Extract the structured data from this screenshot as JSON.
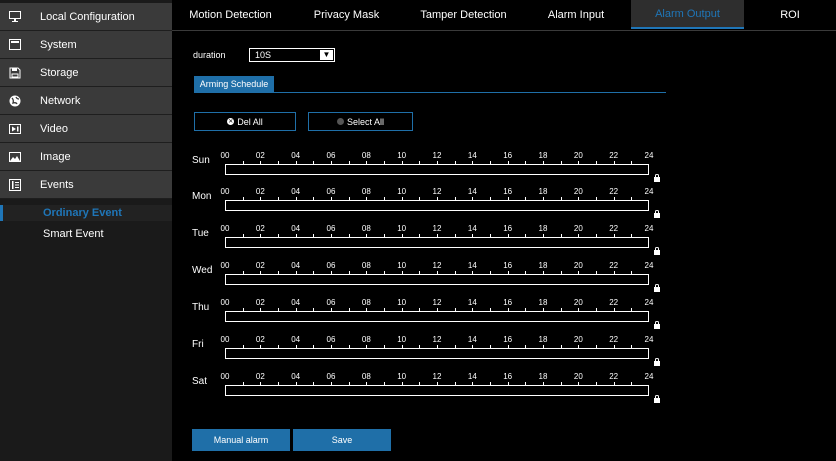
{
  "sidebar": {
    "items": [
      {
        "label": "Local Configuration",
        "icon": "monitor-icon"
      },
      {
        "label": "System",
        "icon": "system-icon"
      },
      {
        "label": "Storage",
        "icon": "storage-icon"
      },
      {
        "label": "Network",
        "icon": "network-globe-icon"
      },
      {
        "label": "Video",
        "icon": "video-icon"
      },
      {
        "label": "Image",
        "icon": "image-icon"
      },
      {
        "label": "Events",
        "icon": "events-icon"
      }
    ],
    "sub_items": [
      {
        "label": "Ordinary Event",
        "active": true
      },
      {
        "label": "Smart Event",
        "active": false
      }
    ]
  },
  "tabs": [
    {
      "label": "Motion Detection",
      "active": false
    },
    {
      "label": "Privacy Mask",
      "active": false
    },
    {
      "label": "Tamper Detection",
      "active": false
    },
    {
      "label": "Alarm Input",
      "active": false
    },
    {
      "label": "Alarm Output",
      "active": true
    },
    {
      "label": "ROI",
      "active": false
    }
  ],
  "duration": {
    "label": "duration",
    "value": "10S"
  },
  "arming_schedule_tab": "Arming Schedule",
  "buttons": {
    "del_all": "Del All",
    "select_all": "Select All",
    "manual_alarm": "Manual alarm",
    "save": "Save"
  },
  "schedule": {
    "days": [
      "Sun",
      "Mon",
      "Tue",
      "Wed",
      "Thu",
      "Fri",
      "Sat"
    ],
    "hours": [
      "00",
      "02",
      "04",
      "06",
      "08",
      "10",
      "12",
      "14",
      "16",
      "18",
      "20",
      "22",
      "24"
    ]
  },
  "colors": {
    "accent": "#1f6fa8",
    "active_text": "#1f76b8",
    "sidebar_row": "#3a3a3a",
    "background": "#000000"
  }
}
